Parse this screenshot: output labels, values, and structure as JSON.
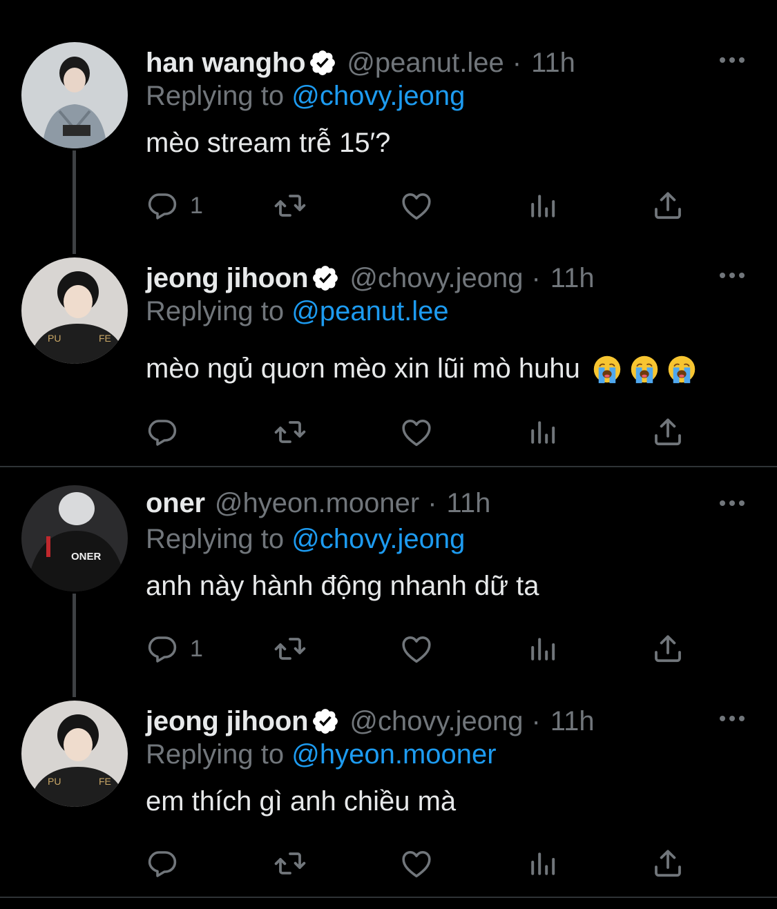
{
  "colors": {
    "background": "#000000",
    "text": "#e7e9ea",
    "muted": "#71767b",
    "accent": "#1d9bf0",
    "verified": "#ffffff"
  },
  "icons": {
    "reply": "reply-icon",
    "retweet": "retweet-icon",
    "like": "heart-icon",
    "views": "views-icon",
    "share": "share-icon",
    "more": "more-icon",
    "verified": "verified-badge-icon",
    "emoji": "loudly-crying-face-emoji"
  },
  "tweets": [
    {
      "name": "han wangho",
      "handle": "@peanut.lee",
      "time": "11h",
      "verified": true,
      "replying_prefix": "Replying to ",
      "replying_to": "@chovy.jeong",
      "text": "mèo stream trễ 15′?",
      "reply_count": "1"
    },
    {
      "name": "jeong jihoon",
      "handle": "@chovy.jeong",
      "time": "11h",
      "verified": true,
      "replying_prefix": "Replying to ",
      "replying_to": "@peanut.lee",
      "text": "mèo ngủ quơn mèo xin lũi mò huhu",
      "emojis": [
        "😭",
        "😭",
        "😭"
      ],
      "reply_count": ""
    },
    {
      "name": "oner",
      "handle": "@hyeon.mooner",
      "time": "11h",
      "verified": false,
      "replying_prefix": "Replying to ",
      "replying_to": "@chovy.jeong",
      "text": "anh này hành động nhanh dữ ta",
      "reply_count": "1"
    },
    {
      "name": "jeong jihoon",
      "handle": "@chovy.jeong",
      "time": "11h",
      "verified": true,
      "replying_prefix": "Replying to ",
      "replying_to": "@hyeon.mooner",
      "text": "em thích gì anh chiều mà",
      "reply_count": ""
    }
  ],
  "separator": "·"
}
